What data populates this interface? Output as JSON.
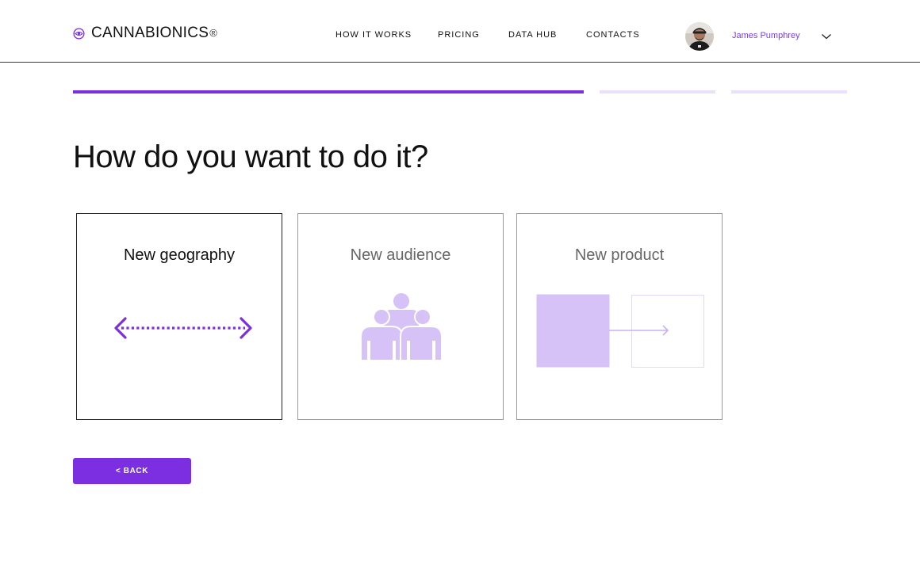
{
  "brand": {
    "name": "CANNABIONICS",
    "registered_mark": "®",
    "icon": "eye-logo-icon"
  },
  "nav": {
    "items": [
      {
        "label": "HOW IT WORKS"
      },
      {
        "label": "PRICING"
      },
      {
        "label": "DATA HUB"
      },
      {
        "label": "CONTACTS"
      }
    ]
  },
  "user": {
    "name": "James Pumphrey",
    "avatar": "user-avatar",
    "menu_icon": "chevron-down-icon"
  },
  "progress": {
    "steps_total": 3,
    "current_step": 1,
    "active_color": "#7b2fe0",
    "inactive_color": "#ebe0fa"
  },
  "question": "How do you want to do it?",
  "options": [
    {
      "label": "New geography",
      "icon": "double-arrow-icon",
      "selected": true
    },
    {
      "label": "New audience",
      "icon": "people-group-icon",
      "selected": false
    },
    {
      "label": "New product",
      "icon": "product-arrow-icon",
      "selected": false
    }
  ],
  "back_button": {
    "label": "< BACK"
  },
  "colors": {
    "accent": "#7b2fe0",
    "accent_light": "#d6c2f7",
    "user_name": "#7a3ee6"
  }
}
